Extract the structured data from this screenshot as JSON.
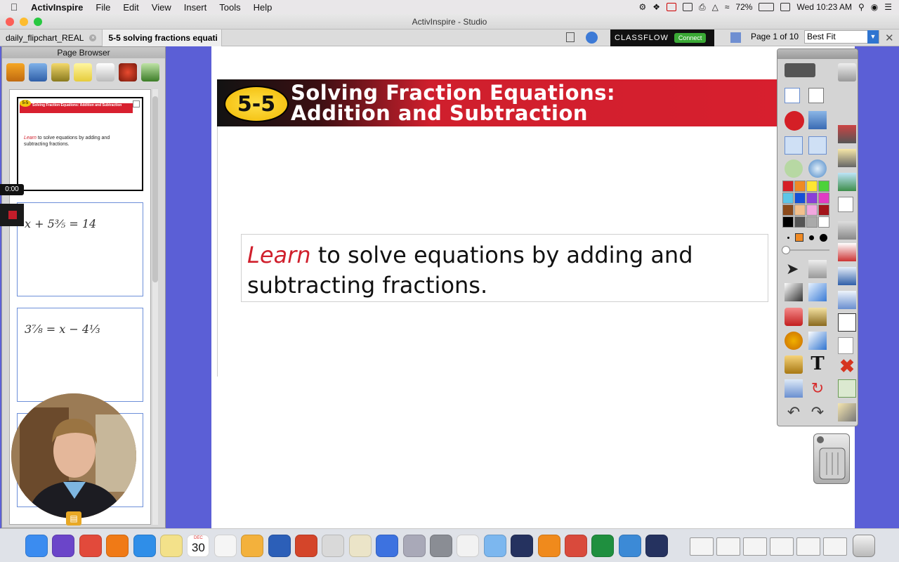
{
  "menubar": {
    "app_name": "ActivInspire",
    "items": [
      "File",
      "Edit",
      "View",
      "Insert",
      "Tools",
      "Help"
    ],
    "battery": "72%",
    "clock": "Wed 10:23 AM"
  },
  "window": {
    "title": "ActivInspire - Studio"
  },
  "tabs": [
    {
      "label": "daily_flipchart_REAL"
    },
    {
      "label": "5-5 solving fractions equati"
    }
  ],
  "classflow": {
    "brand": "CLASSFLOW",
    "button": "Connect"
  },
  "page_indicator": "Page 1 of 10",
  "zoom": "Best Fit",
  "page_browser": {
    "title": "Page Browser",
    "thumbnails": [
      {
        "badge": "5-5",
        "header": "Solving Fraction Equations: Addition and Subtraction",
        "learn": "Learn",
        "text": " to solve equations by adding and subtracting fractions."
      },
      {
        "handwriting": "x + 5⅗ = 14"
      },
      {
        "handwriting": "3⅞ = x − 4⅓"
      }
    ]
  },
  "recorder": {
    "time": "0:00"
  },
  "lesson": {
    "badge": "5-5",
    "title_line1": "Solving Fraction Equations:",
    "title_line2": "Addition and Subtraction",
    "objective_keyword": "Learn",
    "objective_text": " to solve equations by adding and subtracting fractions."
  },
  "colors": {
    "accent_red": "#d71f2e",
    "badge_yellow": "#f1c40f",
    "desktop": "#5b5fd6"
  },
  "palette": [
    "#d61f26",
    "#f08a24",
    "#ffe633",
    "#4cd23a",
    "#5cc6e8",
    "#1450d8",
    "#8a3fd9",
    "#e23bc4",
    "#8b4a1b",
    "#f2c08d",
    "#f1a7df",
    "#a3141a",
    "#000000",
    "#555555",
    "#aaaaaa",
    "#ffffff"
  ],
  "icons": {
    "dock": [
      "finder-icon",
      "siri-icon",
      "chrome-icon",
      "firefox-icon",
      "safari-icon",
      "notes-icon",
      "calendar-icon",
      "reminders-icon",
      "photos-icon",
      "word-icon",
      "powerpoint-icon",
      "preview-icon",
      "jotnot-icon",
      "launchpad-icon",
      "itunes-icon",
      "system-preferences-icon",
      "screenshot-icon",
      "migration-icon",
      "activinspire-icon",
      "vlc-icon",
      "crossover-icon",
      "excel-icon",
      "quicktime-icon",
      "activinspire2-icon",
      "trash-icon"
    ],
    "calendar_date": "30",
    "calendar_month": "DEC"
  }
}
